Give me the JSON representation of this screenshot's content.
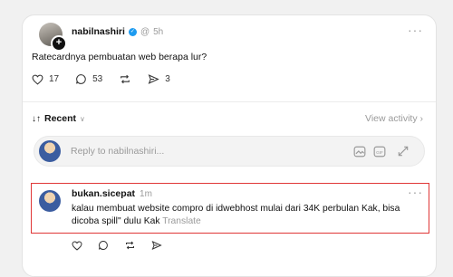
{
  "post": {
    "username": "nabilnashiri",
    "time": "5h",
    "text": "Ratecardnya pembuatan web berapa lur?",
    "likes": "17",
    "comments": "53",
    "shares": "3"
  },
  "filter": {
    "label": "Recent",
    "view_activity": "View activity"
  },
  "reply": {
    "placeholder": "Reply to nabilnashiri..."
  },
  "comment": {
    "username": "bukan.sicepat",
    "time": "1m",
    "text": "kalau membuat website compro di idwebhost mulai dari 34K perbulan Kak, bisa dicoba spill\" dulu Kak",
    "translate": "Translate"
  },
  "colors": {
    "verified": "#1d9bf0",
    "highlight": "#e03636"
  }
}
